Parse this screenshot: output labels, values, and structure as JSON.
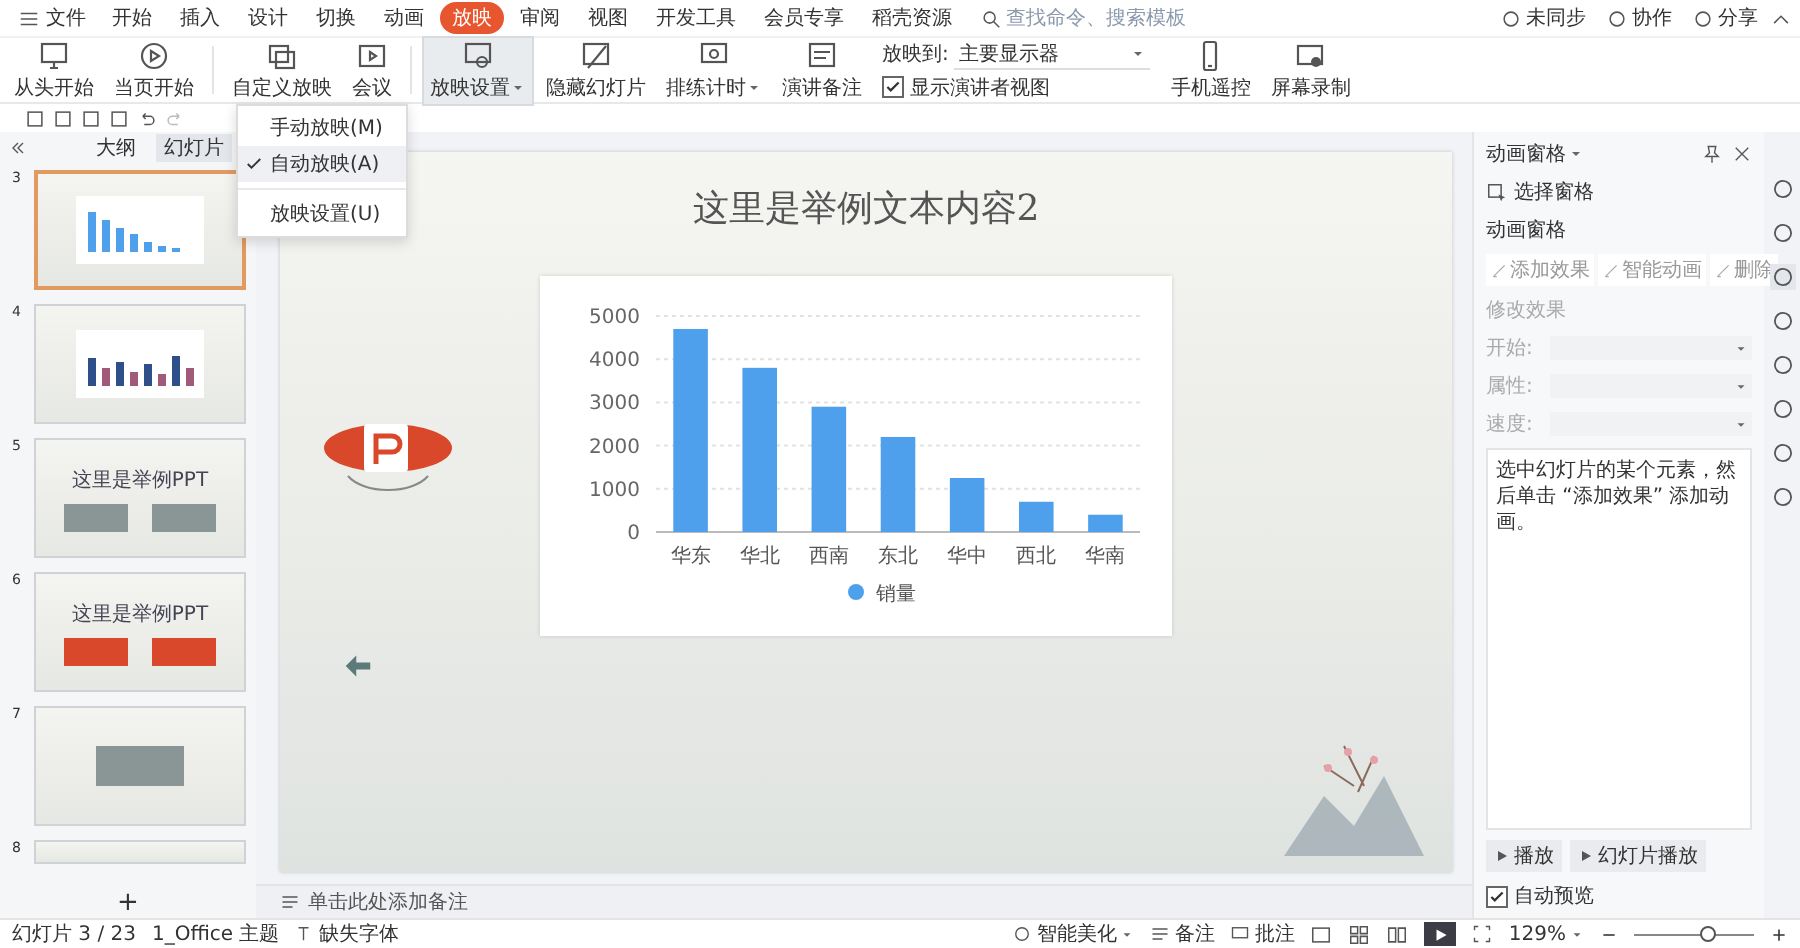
{
  "menubar": {
    "file_label": "文件",
    "tabs": [
      {
        "label": "开始",
        "selected": false
      },
      {
        "label": "插入",
        "selected": false
      },
      {
        "label": "设计",
        "selected": false
      },
      {
        "label": "切换",
        "selected": false
      },
      {
        "label": "动画",
        "selected": false
      },
      {
        "label": "放映",
        "selected": true
      },
      {
        "label": "审阅",
        "selected": false
      },
      {
        "label": "视图",
        "selected": false
      },
      {
        "label": "开发工具",
        "selected": false
      },
      {
        "label": "会员专享",
        "selected": false
      },
      {
        "label": "稻壳资源",
        "selected": false
      }
    ],
    "search": {
      "placeholder": "查找命令、搜索模板"
    },
    "actions": [
      "未同步",
      "协作",
      "分享"
    ]
  },
  "ribbon": {
    "buttons": [
      {
        "label": "从头开始",
        "has_menu": false,
        "selected": false
      },
      {
        "label": "当页开始",
        "has_menu": false,
        "selected": false
      },
      {
        "label": "自定义放映",
        "has_menu": false,
        "selected": false
      },
      {
        "label": "会议",
        "has_menu": false,
        "selected": false
      },
      {
        "label": "放映设置",
        "has_menu": true,
        "selected": true
      },
      {
        "label": "隐藏幻灯片",
        "has_menu": false,
        "selected": false
      },
      {
        "label": "排练计时",
        "has_menu": true,
        "selected": false
      },
      {
        "label": "演讲备注",
        "has_menu": false,
        "selected": false
      }
    ],
    "display": {
      "label": "放映到:",
      "value": "主要显示器"
    },
    "presenter_view": {
      "label": "显示演讲者视图",
      "checked": true
    },
    "extra_buttons": [
      {
        "label": "手机遥控"
      },
      {
        "label": "屏幕录制"
      }
    ]
  },
  "dropdown_menu": {
    "items": [
      {
        "label": "手动放映(M)",
        "selected": false
      },
      {
        "label": "自动放映(A)",
        "selected": true
      },
      {
        "label": "放映设置(U)",
        "selected": false
      }
    ]
  },
  "side_panel": {
    "tabs": [
      {
        "label": "大纲",
        "selected": false
      },
      {
        "label": "幻灯片",
        "selected": true
      }
    ],
    "thumbnails": [
      {
        "number": "3",
        "kind": "bar_chart",
        "selected": true
      },
      {
        "number": "4",
        "kind": "grouped_chart",
        "selected": false
      },
      {
        "number": "5",
        "kind": "two_images",
        "title": "这里是举例PPT",
        "color": "#8a9596",
        "selected": false
      },
      {
        "number": "6",
        "kind": "two_images",
        "title": "这里是举例PPT",
        "color": "#d9482b",
        "selected": false
      },
      {
        "number": "7",
        "kind": "image_caption",
        "selected": false
      },
      {
        "number": "8",
        "kind": "partial",
        "selected": false
      }
    ],
    "add_button": "+"
  },
  "slide": {
    "title": "这里是举例文本内容2",
    "chart_data": {
      "type": "bar",
      "categories": [
        "华东",
        "华北",
        "西南",
        "东北",
        "华中",
        "西北",
        "华南"
      ],
      "series": [
        {
          "name": "销量",
          "color": "#4fa0ec",
          "values": [
            4700,
            3800,
            2900,
            2200,
            1250,
            700,
            400
          ]
        }
      ],
      "ylim": [
        0,
        5000
      ],
      "grid": true,
      "yticks": [
        0,
        1000,
        2000,
        3000,
        4000,
        5000
      ]
    }
  },
  "notes": {
    "placeholder": "单击此处添加备注"
  },
  "animation_pane": {
    "title": "动画窗格",
    "selection_pane": "选择窗格",
    "section_title": "动画窗格",
    "buttons": [
      "添加效果",
      "智能动画",
      "删除"
    ],
    "modify_title": "修改效果",
    "fields": [
      {
        "label": "开始:",
        "disabled": true
      },
      {
        "label": "属性:",
        "disabled": true
      },
      {
        "label": "速度:",
        "disabled": true
      }
    ],
    "hint": "选中幻灯片的某个元素，然后单击 “添加效果” 添加动画。",
    "play_buttons": [
      "播放",
      "幻灯片播放"
    ],
    "auto_preview": {
      "label": "自动预览",
      "checked": true
    }
  },
  "status_bar": {
    "slide_info": "幻灯片 3 / 23",
    "theme": "1_Office 主题",
    "missing_fonts": "缺失字体",
    "beautify": "智能美化",
    "notes": "备注",
    "comments": "批注",
    "zoom": "129%",
    "zoom_level": {
      "level": 0.62
    }
  }
}
